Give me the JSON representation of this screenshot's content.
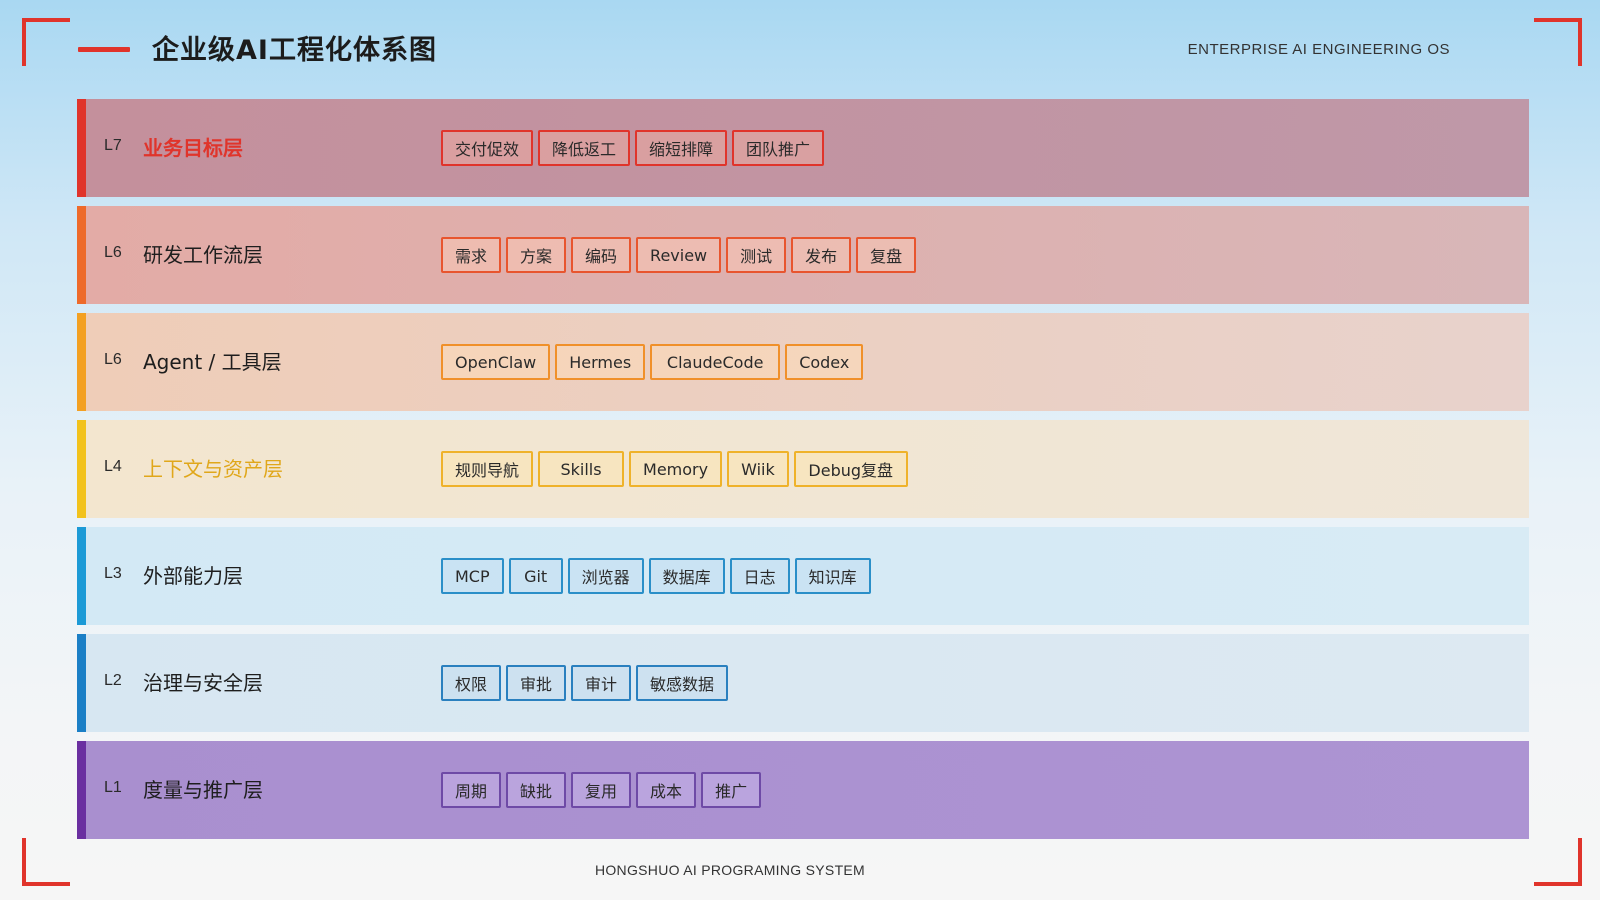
{
  "title": "企业级AI工程化体系图",
  "subtitle": "ENTERPRISE AI ENGINEERING OS",
  "footer": "HONGSHUO AI PROGRAMING SYSTEM",
  "colors": {
    "accent_red": "#e0342b"
  },
  "layers": [
    {
      "level": "L7",
      "name": "业务目标层",
      "tags": [
        "交付促效",
        "降低返工",
        "缩短排障",
        "团队推广"
      ]
    },
    {
      "level": "L6",
      "name": "研发工作流层",
      "tags": [
        "需求",
        "方案",
        "编码",
        "Review",
        "测试",
        "发布",
        "复盘"
      ]
    },
    {
      "level": "L6",
      "name": "Agent / 工具层",
      "tags": [
        "OpenClaw",
        "Hermes",
        "ClaudeCode",
        "Codex"
      ]
    },
    {
      "level": "L4",
      "name": "上下文与资产层",
      "tags": [
        "规则导航",
        "Skills",
        "Memory",
        "Wiik",
        "Debug复盘"
      ]
    },
    {
      "level": "L3",
      "name": "外部能力层",
      "tags": [
        "MCP",
        "Git",
        "浏览器",
        "数据库",
        "日志",
        "知识库"
      ]
    },
    {
      "level": "L2",
      "name": "治理与安全层",
      "tags": [
        "权限",
        "审批",
        "审计",
        "敏感数据"
      ]
    },
    {
      "level": "L1",
      "name": "度量与推广层",
      "tags": [
        "周期",
        "缺批",
        "复用",
        "成本",
        "推广"
      ]
    }
  ]
}
